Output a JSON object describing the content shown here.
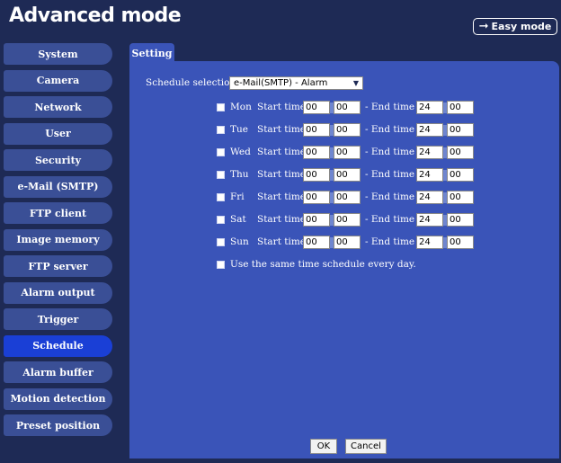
{
  "header": {
    "title": "Advanced mode",
    "easy_mode_label": "Easy mode"
  },
  "sidebar": {
    "items": [
      {
        "label": "System"
      },
      {
        "label": "Camera"
      },
      {
        "label": "Network"
      },
      {
        "label": "User"
      },
      {
        "label": "Security"
      },
      {
        "label": "e-Mail (SMTP)"
      },
      {
        "label": "FTP client"
      },
      {
        "label": "Image memory"
      },
      {
        "label": "FTP server"
      },
      {
        "label": "Alarm output"
      },
      {
        "label": "Trigger"
      },
      {
        "label": "Schedule",
        "active": true
      },
      {
        "label": "Alarm buffer"
      },
      {
        "label": "Motion detection"
      },
      {
        "label": "Preset position"
      }
    ]
  },
  "tab": {
    "label": "Setting"
  },
  "schedule": {
    "selection_label": "Schedule selection",
    "selection_value": "e-Mail(SMTP) - Alarm",
    "start_label": "Start time",
    "end_label": "- End time",
    "days": [
      {
        "day": "Mon",
        "start_h": "00",
        "start_m": "00",
        "end_h": "24",
        "end_m": "00"
      },
      {
        "day": "Tue",
        "start_h": "00",
        "start_m": "00",
        "end_h": "24",
        "end_m": "00"
      },
      {
        "day": "Wed",
        "start_h": "00",
        "start_m": "00",
        "end_h": "24",
        "end_m": "00"
      },
      {
        "day": "Thu",
        "start_h": "00",
        "start_m": "00",
        "end_h": "24",
        "end_m": "00"
      },
      {
        "day": "Fri",
        "start_h": "00",
        "start_m": "00",
        "end_h": "24",
        "end_m": "00"
      },
      {
        "day": "Sat",
        "start_h": "00",
        "start_m": "00",
        "end_h": "24",
        "end_m": "00"
      },
      {
        "day": "Sun",
        "start_h": "00",
        "start_m": "00",
        "end_h": "24",
        "end_m": "00"
      }
    ],
    "same_schedule_label": "Use the same time schedule every day."
  },
  "buttons": {
    "ok": "OK",
    "cancel": "Cancel"
  },
  "colors": {
    "background": "#1e2a55",
    "panel": "#3a54b8",
    "nav": "#3a4f96",
    "nav_active": "#1a3fd6"
  }
}
